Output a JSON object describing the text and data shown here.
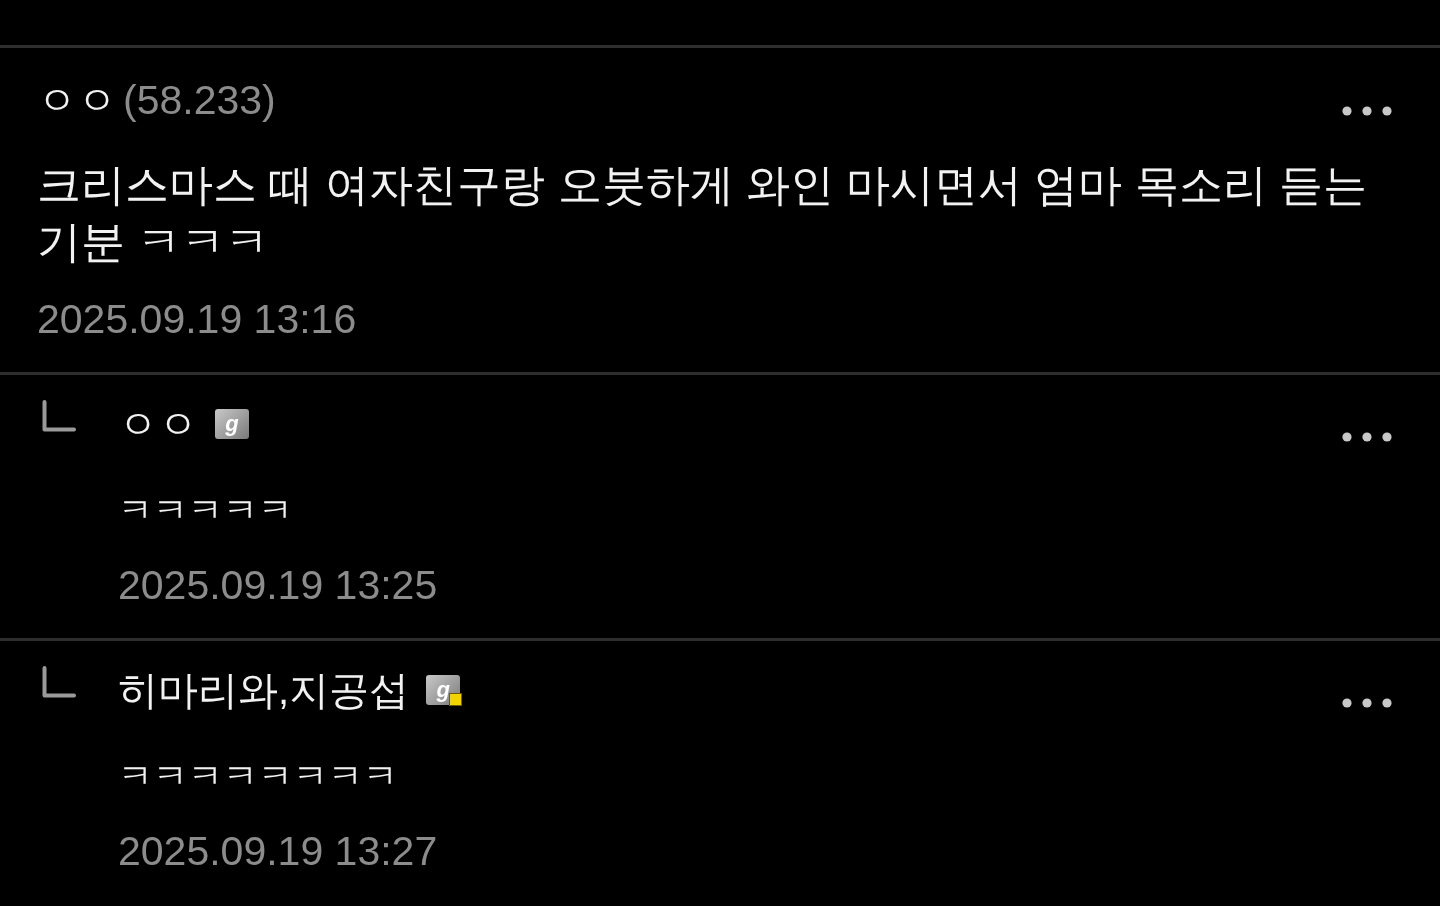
{
  "comments": [
    {
      "author": "ㅇㅇ",
      "ip": "(58.233)",
      "text": "크리스마스 때 여자친구랑 오붓하게 와인 마시면서 엄마 목소리 듣는 기분 ㅋㅋㅋ",
      "time": "2025.09.19 13:16",
      "children": [
        {
          "author": "ㅇㅇ",
          "badge": {
            "label": "g",
            "corner_dot": false
          },
          "text": "ㅋㅋㅋㅋㅋ",
          "time": "2025.09.19 13:25"
        },
        {
          "author": "히마리와,지공섭",
          "badge": {
            "label": "g",
            "corner_dot": true
          },
          "text": "ㅋㅋㅋㅋㅋㅋㅋㅋ",
          "time": "2025.09.19 13:27"
        }
      ]
    }
  ]
}
